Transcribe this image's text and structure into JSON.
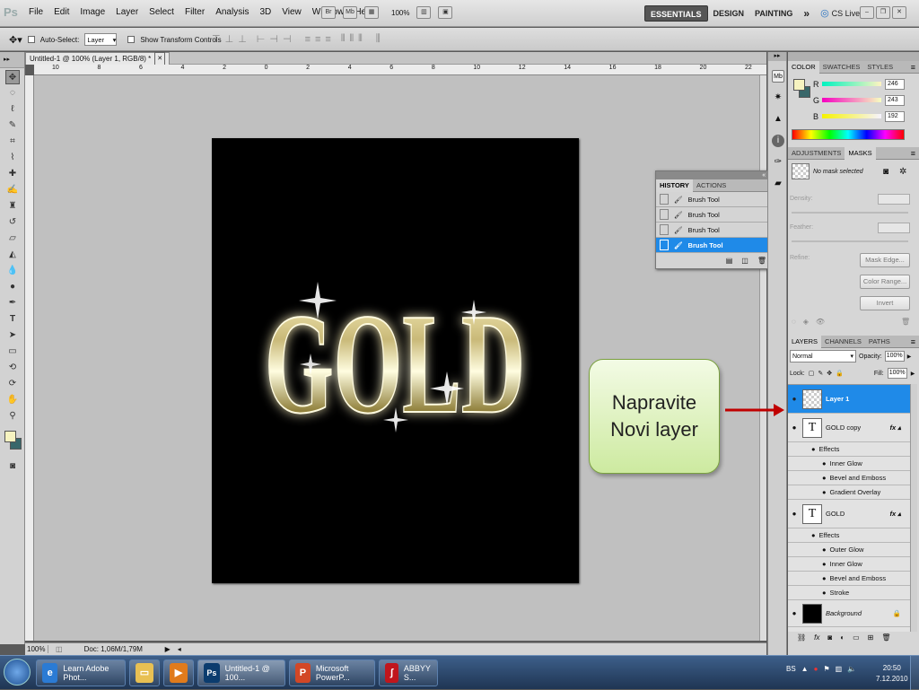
{
  "menubar": {
    "logo": "Ps",
    "menus": [
      "File",
      "Edit",
      "Image",
      "Layer",
      "Select",
      "Filter",
      "Analysis",
      "3D",
      "View",
      "Window",
      "Help"
    ],
    "toolbar_icons": [
      "Br",
      "Mb"
    ],
    "zoom": "100%",
    "workspaces": [
      "ESSENTIALS",
      "DESIGN",
      "PAINTING"
    ],
    "more": "»",
    "cs_live": "CS Live"
  },
  "optionsbar": {
    "auto_select_label": "Auto-Select:",
    "auto_select_value": "Layer",
    "show_transform_label": "Show Transform Controls"
  },
  "document": {
    "tab_title": "Untitled-1 @ 100% (Layer 1, RGB/8) *",
    "canvas_text": "GOLD",
    "ruler_ticks": [
      "10",
      "8",
      "6",
      "4",
      "2",
      "0",
      "2",
      "4",
      "6",
      "8",
      "10",
      "12",
      "14",
      "16",
      "18",
      "20",
      "22"
    ]
  },
  "status": {
    "zoom": "100%",
    "doc_info": "Doc: 1,06M/1,79M"
  },
  "history": {
    "tabs": [
      "HISTORY",
      "ACTIONS"
    ],
    "items": [
      "Brush Tool",
      "Brush Tool",
      "Brush Tool",
      "Brush Tool"
    ]
  },
  "color_panel": {
    "tabs": [
      "COLOR",
      "SWATCHES",
      "STYLES"
    ],
    "r_label": "R",
    "r_value": "246",
    "g_label": "G",
    "g_value": "243",
    "b_label": "B",
    "b_value": "192",
    "fg_color": "#f6f3c0"
  },
  "adjustments_panel": {
    "tabs": [
      "ADJUSTMENTS",
      "MASKS"
    ],
    "no_mask": "No mask selected",
    "density": "Density:",
    "feather": "Feather:",
    "refine": "Refine:",
    "mask_edge": "Mask Edge...",
    "color_range": "Color Range...",
    "invert": "Invert"
  },
  "layers_panel": {
    "tabs": [
      "LAYERS",
      "CHANNELS",
      "PATHS"
    ],
    "blend_mode": "Normal",
    "opacity_label": "Opacity:",
    "opacity_value": "100%",
    "lock_label": "Lock:",
    "fill_label": "Fill:",
    "fill_value": "100%",
    "layer1": "Layer 1",
    "gold_copy": "GOLD copy",
    "effects": "Effects",
    "gold_copy_effects": [
      "Inner Glow",
      "Bevel and Emboss",
      "Gradient Overlay"
    ],
    "gold": "GOLD",
    "gold_effects": [
      "Outer Glow",
      "Inner Glow",
      "Bevel and Emboss",
      "Stroke"
    ],
    "background": "Background"
  },
  "callout": {
    "line1": "Napravite",
    "line2": "Novi layer"
  },
  "taskbar": {
    "items": [
      "Learn Adobe Phot...",
      "Untitled-1 @ 100...",
      "Microsoft PowerP...",
      "ABBYY S..."
    ],
    "lang": "BS",
    "time": "20:50",
    "date": "7.12.2010"
  }
}
